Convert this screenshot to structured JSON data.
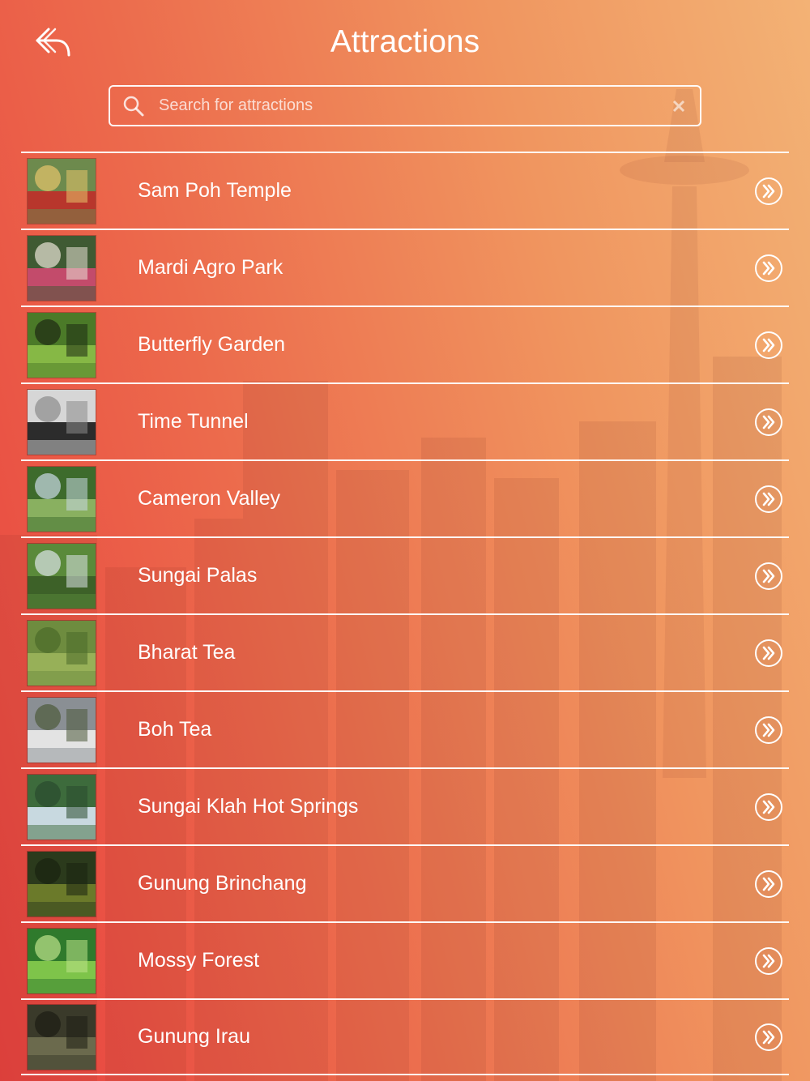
{
  "header": {
    "title": "Attractions"
  },
  "search": {
    "placeholder": "Search for attractions",
    "value": ""
  },
  "attractions": [
    {
      "name": "Sam Poh Temple",
      "thumb_colors": [
        "#6d8a4d",
        "#b8362c",
        "#e7c46b"
      ]
    },
    {
      "name": "Mardi Agro Park",
      "thumb_colors": [
        "#3f5a33",
        "#c34b6b",
        "#e9e2d6"
      ]
    },
    {
      "name": "Butterfly Garden",
      "thumb_colors": [
        "#4b7a28",
        "#86b845",
        "#1e2a12"
      ]
    },
    {
      "name": "Time Tunnel",
      "thumb_colors": [
        "#d6d6d6",
        "#2c2c2c",
        "#8c8c8c"
      ]
    },
    {
      "name": "Cameron Valley",
      "thumb_colors": [
        "#3d6b2c",
        "#89b060",
        "#c9d8e6"
      ]
    },
    {
      "name": "Sungai Palas",
      "thumb_colors": [
        "#5a8a3a",
        "#3d6128",
        "#dce4e8"
      ]
    },
    {
      "name": "Bharat Tea",
      "thumb_colors": [
        "#6e8c3f",
        "#97b058",
        "#4a6a2a"
      ]
    },
    {
      "name": "Boh Tea",
      "thumb_colors": [
        "#8a8f94",
        "#e3e3e3",
        "#4d5a3a"
      ]
    },
    {
      "name": "Sungai Klah Hot Springs",
      "thumb_colors": [
        "#3d6b3c",
        "#c8d9e0",
        "#2a4a2d"
      ]
    },
    {
      "name": "Gunung Brinchang",
      "thumb_colors": [
        "#2b3a1c",
        "#6b7a2a",
        "#1a2210"
      ]
    },
    {
      "name": "Mossy Forest",
      "thumb_colors": [
        "#2f7a2c",
        "#7ec44a",
        "#bde38a"
      ]
    },
    {
      "name": "Gunung Irau",
      "thumb_colors": [
        "#3a3a2a",
        "#6b6a4d",
        "#1d1d14"
      ]
    }
  ],
  "colors": {
    "bg_left": "#e8423f",
    "bg_right": "#f3b275",
    "foreground": "#ffffff"
  },
  "icons": {
    "back": "reply-arrow-icon",
    "search": "search-icon",
    "clear": "clear-icon",
    "row_action": "double-chevron-right-circle-icon"
  }
}
